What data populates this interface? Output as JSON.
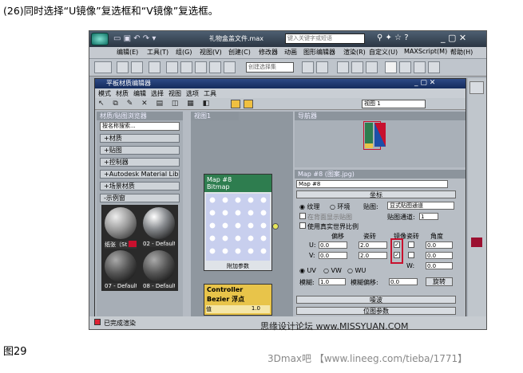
{
  "caption": "(26)同时选择“U镜像”复选框和“V镜像”复选框。",
  "figure_label": "图29",
  "window": {
    "title": "礼物盒盖文件.max",
    "search_placeholder": "键入关键字或短语",
    "menu": [
      "编辑(E)",
      "工具(T)",
      "组(G)",
      "视图(V)",
      "创建(C)",
      "修改器",
      "动画",
      "图形编辑器",
      "渲染(R)",
      "自定义(U)",
      "MAXScript(M)",
      "帮助(H)"
    ],
    "selection_set": "创建选择集"
  },
  "editor": {
    "title": "平板材质编辑器",
    "menu": [
      "模式",
      "材质",
      "编辑",
      "选择",
      "视图",
      "选项",
      "工具"
    ],
    "browser_header": "材质/贴图浏览器",
    "search": "按名称搜索...",
    "categories": [
      "+材质",
      "+贴图",
      "+控制器",
      "+Autodesk Material Library",
      "+场景材质",
      "-示例窗"
    ],
    "thumbs": [
      "纸张（St",
      "02 - Default",
      "07 - Default",
      "08 - Default"
    ],
    "view_tab": "视图1",
    "view_select": "视图 1",
    "nav_header": "导航器",
    "nodes": {
      "bitmap_title": "Map #8",
      "bitmap_sub": "Bitmap",
      "bitmap_footer": "附加参数",
      "ctrl_title": "Controller",
      "ctrl_sub": "Bezier 浮点",
      "ctrl_param": "值",
      "ctrl_value": "1.0"
    },
    "params": {
      "header": "Map #8 (图案.jpg)",
      "name": "Map #8",
      "rollout": "坐标",
      "texture": "纹理",
      "environ": "环境",
      "mapping_label": "贴图:",
      "mapping": "显式贴图通道",
      "show_back": "在背面显示贴图",
      "channel_label": "贴图通道:",
      "channel": "1",
      "real_world": "使用真实世界比例",
      "col_offset": "偏移",
      "col_tiling": "瓷砖",
      "col_mirror": "镜像",
      "col_tile": "瓷砖",
      "col_angle": "角度",
      "u": "U:",
      "v": "V:",
      "w": "W:",
      "u_offset": "0.0",
      "u_tiling": "2.0",
      "u_angle": "0.0",
      "v_offset": "0.0",
      "v_tiling": "2.0",
      "v_angle": "0.0",
      "w_angle": "0.0",
      "uv": "UV",
      "vw": "VW",
      "wu": "WU",
      "blur_label": "模糊:",
      "blur": "1.0",
      "blur_offset_label": "模糊偏移:",
      "blur_offset": "0.0",
      "rotate": "旋转",
      "noise": "噪波",
      "bitmap_params": "位图参数"
    },
    "status": "已完成渲染"
  },
  "watermarks": [
    "思缘设计论坛 www.MISSYUAN.COM",
    "3Dmax吧 【www.lineeg.com/tieba/1771】"
  ],
  "colors": {
    "accent_red": "#c8102e",
    "node_green": "#2e7d4f",
    "node_yellow": "#e8c44a"
  }
}
